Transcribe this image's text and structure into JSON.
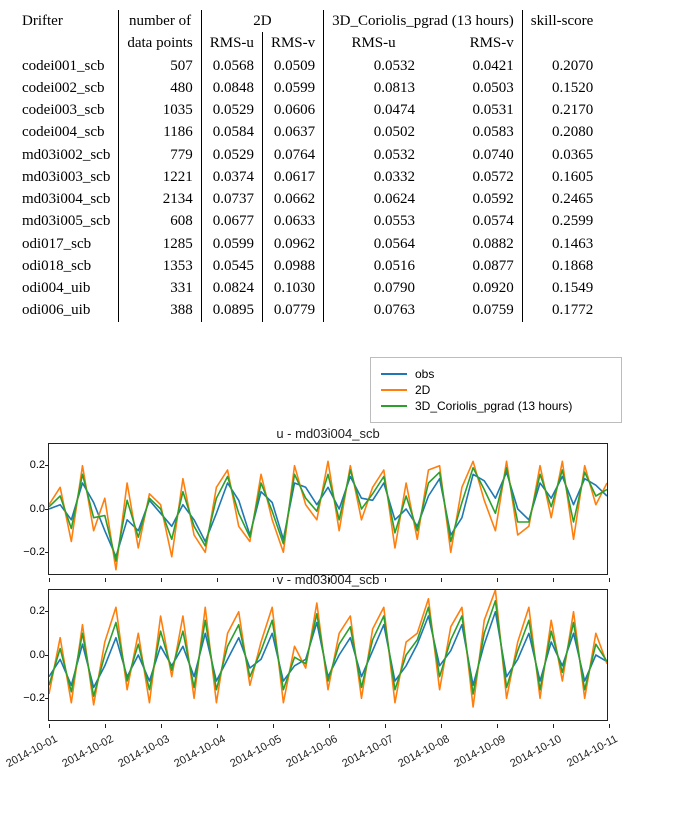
{
  "table": {
    "headers": {
      "drifter": "Drifter",
      "npts_top": "number of",
      "npts_bot": "data points",
      "grp2d": "2D",
      "grp3d": "3D_Coriolis_pgrad (13 hours)",
      "rmsu": "RMS-u",
      "rmsv": "RMS-v",
      "skill": "skill-score"
    },
    "rows": [
      {
        "name": "codei001_scb",
        "n": 507,
        "u2": "0.0568",
        "v2": "0.0509",
        "u3": "0.0532",
        "v3": "0.0421",
        "ss": "0.2070"
      },
      {
        "name": "codei002_scb",
        "n": 480,
        "u2": "0.0848",
        "v2": "0.0599",
        "u3": "0.0813",
        "v3": "0.0503",
        "ss": "0.1520"
      },
      {
        "name": "codei003_scb",
        "n": 1035,
        "u2": "0.0529",
        "v2": "0.0606",
        "u3": "0.0474",
        "v3": "0.0531",
        "ss": "0.2170"
      },
      {
        "name": "codei004_scb",
        "n": 1186,
        "u2": "0.0584",
        "v2": "0.0637",
        "u3": "0.0502",
        "v3": "0.0583",
        "ss": "0.2080"
      },
      {
        "name": "md03i002_scb",
        "n": 779,
        "u2": "0.0529",
        "v2": "0.0764",
        "u3": "0.0532",
        "v3": "0.0740",
        "ss": "0.0365"
      },
      {
        "name": "md03i003_scb",
        "n": 1221,
        "u2": "0.0374",
        "v2": "0.0617",
        "u3": "0.0332",
        "v3": "0.0572",
        "ss": "0.1605"
      },
      {
        "name": "md03i004_scb",
        "n": 2134,
        "u2": "0.0737",
        "v2": "0.0662",
        "u3": "0.0624",
        "v3": "0.0592",
        "ss": "0.2465"
      },
      {
        "name": "md03i005_scb",
        "n": 608,
        "u2": "0.0677",
        "v2": "0.0633",
        "u3": "0.0553",
        "v3": "0.0574",
        "ss": "0.2599"
      },
      {
        "name": "odi017_scb",
        "n": 1285,
        "u2": "0.0599",
        "v2": "0.0962",
        "u3": "0.0564",
        "v3": "0.0882",
        "ss": "0.1463"
      },
      {
        "name": "odi018_scb",
        "n": 1353,
        "u2": "0.0545",
        "v2": "0.0988",
        "u3": "0.0516",
        "v3": "0.0877",
        "ss": "0.1868"
      },
      {
        "name": "odi004_uib",
        "n": 331,
        "u2": "0.0824",
        "v2": "0.1030",
        "u3": "0.0790",
        "v3": "0.0920",
        "ss": "0.1549"
      },
      {
        "name": "odi006_uib",
        "n": 388,
        "u2": "0.0895",
        "v2": "0.0779",
        "u3": "0.0763",
        "v3": "0.0759",
        "ss": "0.1772"
      }
    ]
  },
  "legend": {
    "items": [
      {
        "label": "obs",
        "color": "#1f77b4"
      },
      {
        "label": "2D",
        "color": "#ff7f0e"
      },
      {
        "label": "3D_Coriolis_pgrad (13 hours)",
        "color": "#2ca02c"
      }
    ]
  },
  "chart_data": [
    {
      "type": "line",
      "title": "u - md03i004_scb",
      "ylim": [
        -0.3,
        0.3
      ],
      "yticks": [
        -0.2,
        0.0,
        0.2
      ],
      "x_start": "2014-10-01",
      "x_end": "2014-10-11",
      "x_days": 10,
      "series": [
        {
          "name": "obs",
          "color": "#1f77b4",
          "values": [
            0.0,
            0.02,
            -0.05,
            0.12,
            0.03,
            -0.1,
            -0.22,
            -0.05,
            -0.1,
            0.04,
            -0.02,
            -0.08,
            0.02,
            -0.05,
            -0.15,
            -0.02,
            0.12,
            0.04,
            -0.12,
            0.08,
            0.03,
            -0.14,
            0.12,
            0.1,
            0.02,
            0.1,
            0.0,
            0.15,
            0.05,
            0.04,
            0.12,
            -0.05,
            0.0,
            -0.08,
            0.06,
            0.14,
            -0.12,
            -0.04,
            0.16,
            0.13,
            0.05,
            0.17,
            0.0,
            -0.05,
            0.12,
            0.05,
            0.15,
            0.02,
            0.14,
            0.11,
            0.06
          ]
        },
        {
          "name": "2D",
          "color": "#ff7f0e",
          "values": [
            0.02,
            0.1,
            -0.15,
            0.2,
            -0.1,
            0.05,
            -0.28,
            0.12,
            -0.18,
            0.07,
            0.02,
            -0.22,
            0.14,
            -0.12,
            -0.2,
            0.1,
            0.18,
            -0.08,
            -0.15,
            0.16,
            -0.05,
            -0.2,
            0.2,
            0.02,
            -0.05,
            0.22,
            -0.1,
            0.2,
            -0.05,
            0.1,
            0.18,
            -0.18,
            0.12,
            -0.14,
            0.18,
            0.2,
            -0.2,
            0.1,
            0.22,
            0.04,
            -0.1,
            0.22,
            -0.12,
            -0.08,
            0.2,
            -0.04,
            0.22,
            -0.14,
            0.2,
            0.02,
            0.12
          ]
        },
        {
          "name": "3D_Coriolis_pgrad (13 hours)",
          "color": "#2ca02c",
          "values": [
            0.01,
            0.06,
            -0.09,
            0.16,
            -0.04,
            -0.03,
            -0.24,
            0.04,
            -0.13,
            0.05,
            0.0,
            -0.14,
            0.08,
            -0.08,
            -0.17,
            0.05,
            0.15,
            -0.02,
            -0.13,
            0.12,
            -0.01,
            -0.16,
            0.16,
            0.05,
            -0.01,
            0.16,
            -0.05,
            0.18,
            0.0,
            0.07,
            0.15,
            -0.11,
            0.06,
            -0.1,
            0.12,
            0.17,
            -0.15,
            0.03,
            0.19,
            0.09,
            -0.02,
            0.19,
            -0.06,
            -0.06,
            0.16,
            0.01,
            0.18,
            -0.06,
            0.17,
            0.06,
            0.09
          ]
        }
      ]
    },
    {
      "type": "line",
      "title": "v - md03i004_scb",
      "ylim": [
        -0.3,
        0.3
      ],
      "yticks": [
        -0.2,
        0.0,
        0.2
      ],
      "x_start": "2014-10-01",
      "x_end": "2014-10-11",
      "x_days": 10,
      "xticklabels": [
        "2014-10-01",
        "2014-10-02",
        "2014-10-03",
        "2014-10-04",
        "2014-10-05",
        "2014-10-06",
        "2014-10-07",
        "2014-10-08",
        "2014-10-09",
        "2014-10-10",
        "2014-10-11"
      ],
      "series": [
        {
          "name": "obs",
          "color": "#1f77b4",
          "values": [
            -0.1,
            -0.02,
            -0.14,
            0.05,
            -0.15,
            -0.05,
            0.08,
            -0.1,
            0.0,
            -0.12,
            0.04,
            -0.05,
            0.04,
            -0.1,
            0.1,
            -0.12,
            -0.02,
            0.08,
            -0.06,
            -0.02,
            0.1,
            -0.12,
            -0.05,
            -0.02,
            0.15,
            -0.1,
            0.0,
            0.08,
            -0.1,
            0.02,
            0.14,
            -0.12,
            -0.05,
            0.05,
            0.18,
            -0.05,
            0.02,
            0.14,
            -0.14,
            0.05,
            0.2,
            -0.1,
            -0.02,
            0.1,
            -0.12,
            0.06,
            -0.05,
            0.1,
            -0.12,
            0.0,
            -0.03
          ]
        },
        {
          "name": "2D",
          "color": "#ff7f0e",
          "values": [
            -0.18,
            0.08,
            -0.22,
            0.14,
            -0.23,
            0.06,
            0.22,
            -0.16,
            0.1,
            -0.22,
            0.18,
            -0.1,
            0.18,
            -0.2,
            0.22,
            -0.22,
            0.1,
            0.2,
            -0.14,
            0.06,
            0.22,
            -0.22,
            0.04,
            -0.06,
            0.24,
            -0.16,
            0.1,
            0.18,
            -0.2,
            0.12,
            0.22,
            -0.22,
            0.06,
            0.1,
            0.26,
            -0.16,
            0.13,
            0.22,
            -0.24,
            0.16,
            0.3,
            -0.2,
            0.06,
            0.22,
            -0.2,
            0.16,
            -0.12,
            0.2,
            -0.2,
            0.1,
            -0.04
          ]
        },
        {
          "name": "3D_Coriolis_pgrad (13 hours)",
          "color": "#2ca02c",
          "values": [
            -0.14,
            0.03,
            -0.17,
            0.1,
            -0.19,
            0.0,
            0.15,
            -0.12,
            0.05,
            -0.16,
            0.11,
            -0.07,
            0.11,
            -0.15,
            0.16,
            -0.16,
            0.04,
            0.14,
            -0.1,
            0.02,
            0.16,
            -0.16,
            -0.01,
            -0.04,
            0.19,
            -0.12,
            0.05,
            0.13,
            -0.15,
            0.07,
            0.18,
            -0.16,
            0.0,
            0.07,
            0.22,
            -0.1,
            0.07,
            0.18,
            -0.18,
            0.1,
            0.25,
            -0.15,
            0.02,
            0.16,
            -0.16,
            0.11,
            -0.08,
            0.15,
            -0.16,
            0.05,
            -0.03
          ]
        }
      ]
    }
  ]
}
